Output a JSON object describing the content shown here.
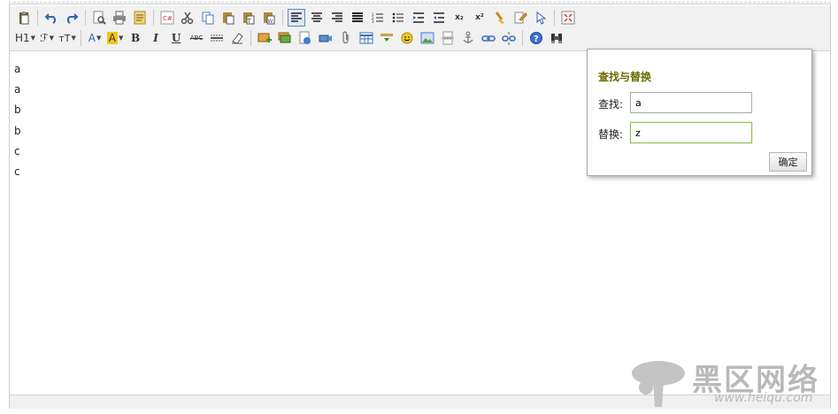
{
  "toolbar": {
    "heading_label": "H1",
    "font_family_label": "ℱ",
    "font_size_label": "тT",
    "font_color_label": "A",
    "highlight_label": "A",
    "bold_label": "B",
    "italic_label": "I",
    "underline_label": "U",
    "strike_label": "ABC",
    "subscript_label": "x₂",
    "superscript_label": "x²",
    "icon_names": [
      "paste-icon",
      "undo-icon",
      "redo-icon",
      "preview-icon",
      "print-icon",
      "template-icon",
      "code-icon",
      "cut-icon",
      "copy-icon",
      "paste-plain-icon",
      "paste-text-icon",
      "paste-word-icon",
      "align-left-icon",
      "align-center-icon",
      "align-right-icon",
      "align-justify-icon",
      "ordered-list-icon",
      "unordered-list-icon",
      "indent-icon",
      "outdent-icon",
      "subscript-icon",
      "superscript-icon",
      "clear-format-icon",
      "format-painter-icon",
      "select-all-icon",
      "fullscreen-icon",
      "heading-icon",
      "font-family-icon",
      "font-size-icon",
      "font-color-icon",
      "highlight-icon",
      "bold-icon",
      "italic-icon",
      "underline-icon",
      "strikethrough-icon",
      "hr-icon",
      "eraser-icon",
      "insert-image-icon",
      "multi-image-icon",
      "flash-icon",
      "video-icon",
      "attachment-icon",
      "table-icon",
      "insert-row-icon",
      "emoticon-icon",
      "image-icon",
      "page-break-icon",
      "anchor-icon",
      "link-icon",
      "unlink-icon",
      "help-icon",
      "find-replace-icon"
    ]
  },
  "editor": {
    "lines": [
      "a",
      "a",
      "b",
      "b",
      "c",
      "c"
    ]
  },
  "dialog": {
    "title": "查找与替换",
    "find_label": "查找:",
    "find_value": "a",
    "replace_label": "替换:",
    "replace_value": "z",
    "ok_label": "确定"
  },
  "watermark": {
    "text": "黑区网络",
    "url": "www.heiqu.com"
  },
  "colors": {
    "accent": "#5b86c5",
    "dialog_title": "#6a6a00",
    "focus_border": "#8fbf4f"
  }
}
